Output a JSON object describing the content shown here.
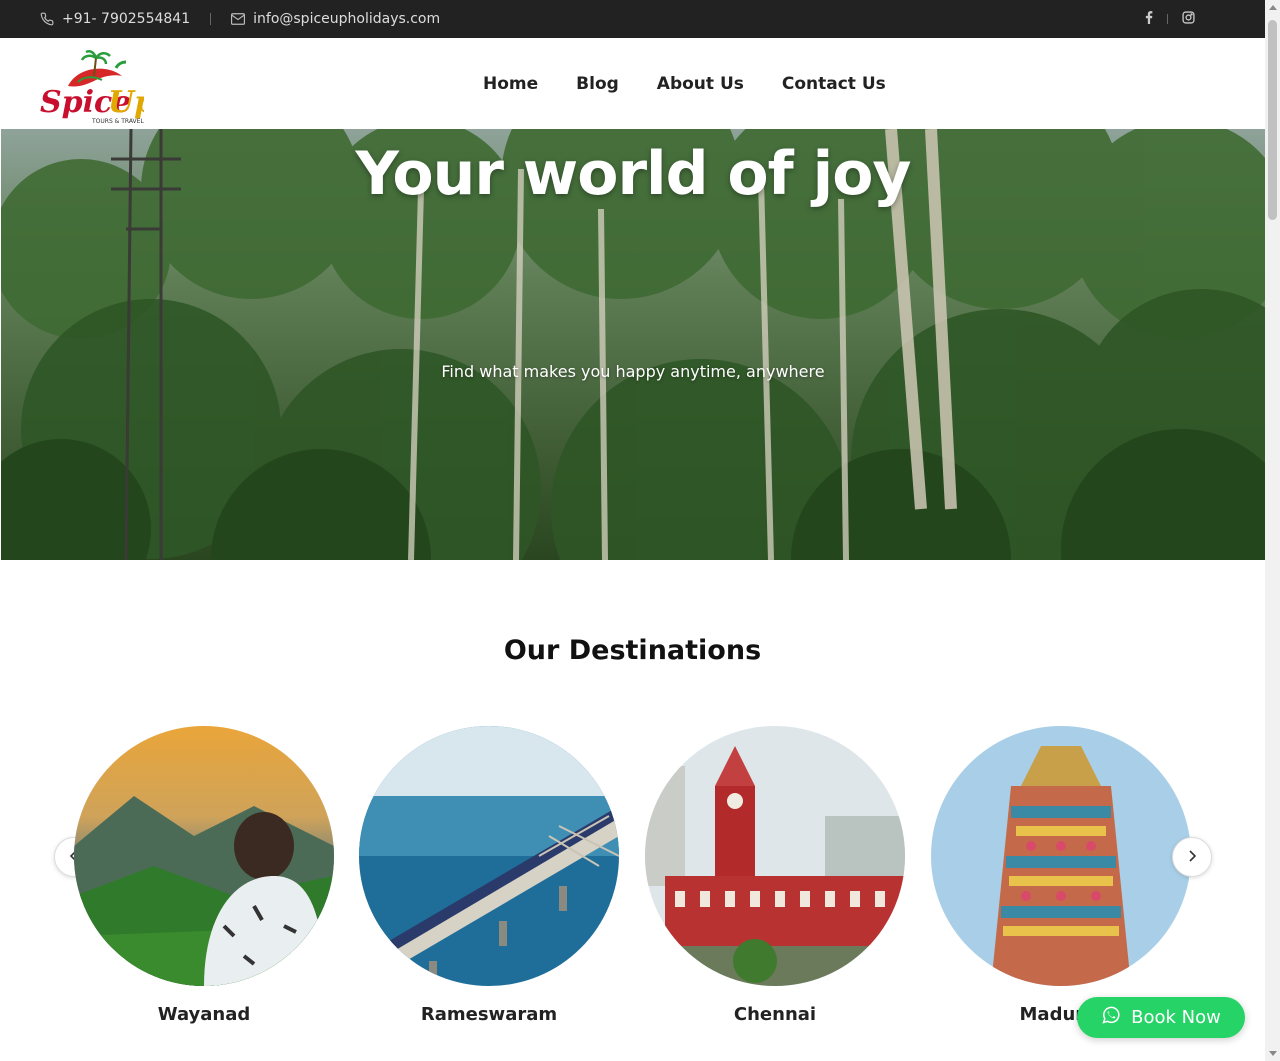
{
  "topbar": {
    "phone": "+91- 7902554841",
    "email": "info@spiceupholidays.com",
    "phone_icon": "phone-icon",
    "email_icon": "envelope-icon",
    "social": [
      "facebook-icon",
      "instagram-icon"
    ]
  },
  "header": {
    "logo_text": "SpiceUp",
    "logo_subtext": "TOURS & TRAVELS",
    "nav": [
      "Home",
      "Blog",
      "About Us",
      "Contact Us"
    ]
  },
  "hero": {
    "title": "Your world of joy",
    "subtitle": "Find what makes you happy anytime, anywhere"
  },
  "destinations": {
    "title": "Our Destinations",
    "items": [
      {
        "name": "Wayanad"
      },
      {
        "name": "Rameswaram"
      },
      {
        "name": "Chennai"
      },
      {
        "name": "Madurai"
      }
    ]
  },
  "book_now": "Book Now",
  "colors": {
    "topbar_bg": "#222222",
    "accent_green": "#25d366",
    "logo_red": "#c8102e"
  }
}
